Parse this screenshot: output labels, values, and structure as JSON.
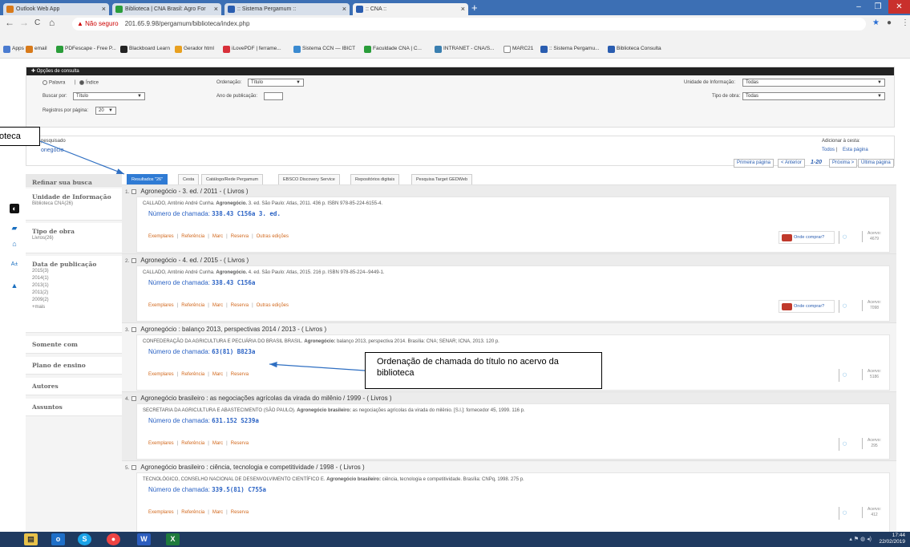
{
  "browser": {
    "tabs": [
      {
        "label": "Outlook Web App",
        "icon_color": "#d87a1a"
      },
      {
        "label": "Biblioteca | CNA Brasil: Agro For",
        "icon_color": "#2a9d3a"
      },
      {
        "label": ":: Sistema Pergamum ::",
        "icon_color": "#2a5db0"
      },
      {
        "label": ":: CNA ::",
        "icon_color": "#2a5db0"
      }
    ],
    "new_tab": "+",
    "window_controls": {
      "minimize": "–",
      "maximize": "❐",
      "close": "✕"
    },
    "address": {
      "security_label": "Não seguro",
      "url": "201.65.9.98/pergamum/biblioteca/index.php"
    },
    "nav": {
      "back": "←",
      "forward": "→",
      "reload": "C",
      "home": "⌂",
      "star": "★",
      "profile": "●",
      "menu": "⋮"
    },
    "bookmarks": [
      "Apps",
      "email",
      "PDFescape - Free P...",
      "Blackboard Learn",
      "Gerador html",
      "iLovePDF | ferrame...",
      "Sistema CCN — IBICT",
      "Faculdade CNA | C...",
      "INTRANET - CNA/S...",
      "MARC21",
      ":: Sistema Pergamu...",
      "Biblioteca Consulta"
    ]
  },
  "options_panel": {
    "title": "Opções de consulta",
    "radio_palavra": "Palavra",
    "radio_sep": "|",
    "radio_indice": "Índice",
    "ordenacao_label": "Ordenação:",
    "ordenacao_value": "Título",
    "unidade_label": "Unidade de Informação:",
    "unidade_value": "Todas",
    "buscar_label": "Buscar por:",
    "buscar_value": "Título",
    "ano_label": "Ano de publicação:",
    "ano_value": "",
    "tipo_label": "Tipo de obra:",
    "tipo_value": "Todas",
    "registros_label": "Registros por página:",
    "registros_value": "20"
  },
  "searched": {
    "label": "pesquisado",
    "term": "onegócio",
    "add_label": "Adicionar à cesta:",
    "add_todos": "Todos",
    "add_sep": "|",
    "add_pagina": "Esta página"
  },
  "pagination": {
    "first": "Primeira página",
    "prev": "< Anterior",
    "range": "1-20",
    "next": "Próxima >",
    "last": "Última página"
  },
  "sidebar": {
    "title": "Refinar sua busca",
    "unidade": {
      "title": "Unidade de Informação",
      "items": [
        "Biblioteca CNA(26)"
      ]
    },
    "tipo": {
      "title": "Tipo de obra",
      "items": [
        "Livros(26)"
      ]
    },
    "data": {
      "title": "Data de publicação",
      "items": [
        "2015(3)",
        "2014(1)",
        "2013(1)",
        "2011(2)",
        "2009(2)"
      ],
      "more": "+mais"
    },
    "somente": "Somente com",
    "plano": "Plano de ensino",
    "autores": "Autores",
    "assuntos": "Assuntos"
  },
  "result_tabs": [
    "Resultados \"26\"",
    "Cesta",
    "Catálogo/Rede Pergamum",
    "EBSCO Discovery Service",
    "Repositórios digitais",
    "Pesquisa Target GEDWeb"
  ],
  "records": [
    {
      "num": "1.",
      "title": "Agronegócio - 3. ed. / 2011 - ( Livros )",
      "cite_pre": "CALLADO, Antônio André Cunha.",
      "cite_bold": "Agronegócio.",
      "cite_post": "3. ed. São Paulo: Atlas, 2011. 436 p. ISBN 978-85-224-6155-4.",
      "call_label": "Número de chamada:",
      "call": "338.43 C156a 3. ed.",
      "links": [
        "Exemplares",
        "Referência",
        "Marc",
        "Reserva",
        "Outras edições"
      ],
      "where": "Onde comprar?",
      "acervo": "Acervo:",
      "acervo_n": "4679"
    },
    {
      "num": "2.",
      "title": "Agronegócio - 4. ed. / 2015 - ( Livros )",
      "cite_pre": "CALLADO, Antônio André Cunha.",
      "cite_bold": "Agronegócio.",
      "cite_post": "4. ed. São Paulo: Atlas, 2015. 216 p. ISBN 978-85-224--9449-1.",
      "call_label": "Número de chamada:",
      "call": "338.43 C156a",
      "links": [
        "Exemplares",
        "Referência",
        "Marc",
        "Reserva",
        "Outras edições"
      ],
      "where": "Onde comprar?",
      "acervo": "Acervo:",
      "acervo_n": "7098"
    },
    {
      "num": "3.",
      "title": "Agronegócio : balanço 2013, perspectivas 2014 / 2013 - ( Livros )",
      "cite_pre": "CONFEDERAÇÃO DA AGRICULTURA E PECUÁRIA DO BRASIL BRASIL.",
      "cite_bold": "Agronegócio:",
      "cite_post": "balanço 2013, perspectiva 2014. Brasília: CNA; SENAR; ICNA, 2013. 120 p.",
      "call_label": "Número de chamada:",
      "call": "63(81) B823a",
      "links": [
        "Exemplares",
        "Referência",
        "Marc",
        "Reserva"
      ],
      "acervo": "Acervo:",
      "acervo_n": "5186"
    },
    {
      "num": "4.",
      "title": "Agronegócio brasileiro : as negociações agrícolas da virada do milênio / 1999 - ( Livros )",
      "cite_pre": "SECRETARIA DA AGRICULTURA E ABASTECIMENTO (SÃO PAULO).",
      "cite_bold": "Agronegócio brasileiro:",
      "cite_post": "as negociações agrícolas da virada do milênio. [S.l.]: fornecedor 45, 1999. 116 p.",
      "call_label": "Número de chamada:",
      "call": "631.152 S239a",
      "links": [
        "Exemplares",
        "Referência",
        "Marc",
        "Reserva"
      ],
      "acervo": "Acervo:",
      "acervo_n": "295"
    },
    {
      "num": "5.",
      "title": "Agronegócio brasileiro : ciência, tecnologia e competitividade / 1998 - ( Livros )",
      "cite_pre": "TECNOLÓGICO, CONSELHO NACIONAL DE DESENVOLVIMENTO CIENTÍFICO E.",
      "cite_bold": "Agronegócio brasileiro:",
      "cite_post": "ciência, tecnologia e competitividade. Brasília: CNPq, 1998. 275 p.",
      "call_label": "Número de chamada:",
      "call": "339.5(81) C755a",
      "links": [
        "Exemplares",
        "Referência",
        "Marc",
        "Reserva"
      ],
      "acervo": "Acervo:",
      "acervo_n": "412"
    }
  ],
  "annotations": {
    "left": "oteca",
    "right": "Ordenação de chamada do título no acervo da  biblioteca"
  },
  "taskbar": {
    "apps": [
      "explorer-icon",
      "outlook-icon",
      "skype-icon",
      "chrome-icon",
      "word-icon",
      "excel-icon"
    ],
    "time": "17:44",
    "date": "22/02/2019"
  }
}
